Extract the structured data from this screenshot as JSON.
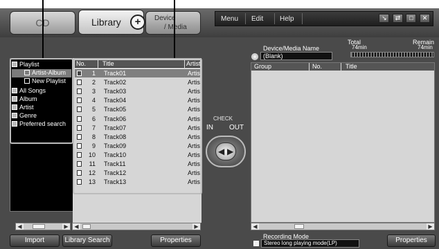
{
  "header": {
    "cd_label": "CD",
    "library_label": "Library",
    "plus_symbol": "+",
    "device_label_line1": "Device",
    "device_label_line2": "/ Media"
  },
  "menu": {
    "items": [
      "Menu",
      "Edit",
      "Help"
    ],
    "window_buttons": [
      "↘",
      "⇄",
      "□",
      "✕"
    ]
  },
  "tree": {
    "items": [
      {
        "label": "Playlist",
        "icon": "playlist-folder-icon"
      },
      {
        "label": "Artist-Album",
        "icon": "playlist-icon"
      },
      {
        "label": "New Playlist",
        "icon": "playlist-icon"
      },
      {
        "label": "All Songs",
        "icon": "all-songs-icon"
      },
      {
        "label": "Album",
        "icon": "album-folder-icon"
      },
      {
        "label": "Artist",
        "icon": "artist-folder-icon"
      },
      {
        "label": "Genre",
        "icon": "genre-folder-icon"
      },
      {
        "label": "Preferred search",
        "icon": "search-icon"
      }
    ]
  },
  "tracks": {
    "columns": [
      "No.",
      "Title",
      "Artist"
    ],
    "rows": [
      {
        "no": "1",
        "title": "Track01",
        "artist": "Artist"
      },
      {
        "no": "2",
        "title": "Track02",
        "artist": "Artist"
      },
      {
        "no": "3",
        "title": "Track03",
        "artist": "Artist"
      },
      {
        "no": "4",
        "title": "Track04",
        "artist": "Artist"
      },
      {
        "no": "5",
        "title": "Track05",
        "artist": "Artist"
      },
      {
        "no": "6",
        "title": "Track06",
        "artist": "Artist"
      },
      {
        "no": "7",
        "title": "Track07",
        "artist": "Artist"
      },
      {
        "no": "8",
        "title": "Track08",
        "artist": "Artist"
      },
      {
        "no": "9",
        "title": "Track09",
        "artist": "Artist"
      },
      {
        "no": "10",
        "title": "Track10",
        "artist": "Artist"
      },
      {
        "no": "11",
        "title": "Track11",
        "artist": "Artist"
      },
      {
        "no": "12",
        "title": "Track12",
        "artist": "Artist"
      },
      {
        "no": "13",
        "title": "Track13",
        "artist": "Artist"
      }
    ],
    "selected_index": 0
  },
  "transfer": {
    "check_label": "CHECK",
    "in_label": "IN",
    "out_label": "OUT"
  },
  "device": {
    "name_label": "Device/Media Name",
    "name_value": "(Blank)",
    "total_label": "Total",
    "total_value": "74min",
    "remain_label": "Remain",
    "remain_value": "74min",
    "columns": [
      "Group",
      "No.",
      "Title"
    ]
  },
  "recording": {
    "label": "Recording Mode",
    "value": "Stereo long playing mode(LP)"
  },
  "buttons": {
    "import": "Import",
    "library_search": "Library Search",
    "properties_left": "Properties",
    "properties_right": "Properties"
  }
}
